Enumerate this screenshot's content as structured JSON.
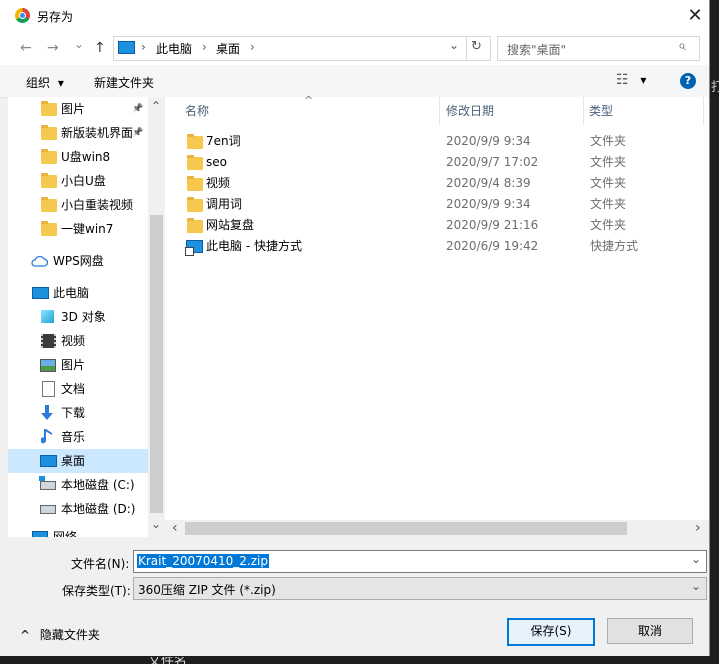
{
  "window": {
    "title": "另存为",
    "close_glyph": "✕"
  },
  "nav": {
    "back_glyph": "←",
    "forward_glyph": "→",
    "history_glyph": "⌄",
    "up_glyph": "↑",
    "breadcrumbs": [
      "此电脑",
      "桌面"
    ],
    "sep": "›",
    "addr_dropdown_glyph": "⌄",
    "refresh_glyph": "↻",
    "search_placeholder": "搜索\"桌面\"",
    "search_glyph": "⌕"
  },
  "toolbar": {
    "organize_label": "组织",
    "organize_arrow": "▾",
    "new_folder_label": "新建文件夹",
    "view_glyph": "☷",
    "view_arrow": "▾",
    "help_glyph": "?"
  },
  "tree": {
    "quick": [
      {
        "label": "图片",
        "pinned": true
      },
      {
        "label": "新版装机界面",
        "pinned": true
      },
      {
        "label": "U盘win8",
        "pinned": false
      },
      {
        "label": "小白U盘",
        "pinned": false
      },
      {
        "label": "小白重装视频",
        "pinned": false
      },
      {
        "label": "一键win7",
        "pinned": false
      }
    ],
    "pin_glyph": "📌",
    "cloud": "WPS网盘",
    "pc": "此电脑",
    "pc_children": [
      "3D 对象",
      "视频",
      "图片",
      "文档",
      "下载",
      "音乐",
      "桌面",
      "本地磁盘 (C:)",
      "本地磁盘 (D:)"
    ],
    "selected": "桌面",
    "partial_label": "网络",
    "scroll_up": "⌃",
    "scroll_down": "⌄"
  },
  "columns": {
    "name": "名称",
    "date": "修改日期",
    "type": "类型",
    "sort_glyph": "^"
  },
  "files": [
    {
      "name": "7en词",
      "date": "2020/9/9 9:34",
      "type": "文件夹",
      "icon": "folder-icon"
    },
    {
      "name": "seo",
      "date": "2020/9/7 17:02",
      "type": "文件夹",
      "icon": "folder-icon"
    },
    {
      "name": "视频",
      "date": "2020/9/4 8:39",
      "type": "文件夹",
      "icon": "folder-icon"
    },
    {
      "name": "调用词",
      "date": "2020/9/9 9:34",
      "type": "文件夹",
      "icon": "folder-icon"
    },
    {
      "name": "网站复盘",
      "date": "2020/9/9 21:16",
      "type": "文件夹",
      "icon": "folder-icon"
    },
    {
      "name": "此电脑 - 快捷方式",
      "date": "2020/6/9 19:42",
      "type": "快捷方式",
      "icon": "computer-shortcut-icon"
    }
  ],
  "hscroll": {
    "left": "‹",
    "right": "›"
  },
  "form": {
    "filename_label": "文件名(N):",
    "filename_value": "Krait_20070410_2.zip",
    "filetype_label": "保存类型(T):",
    "filetype_value": "360压缩 ZIP 文件 (*.zip)",
    "dropdown_glyph": "⌄"
  },
  "footer": {
    "hide_folders_label": "隐藏文件夹",
    "hide_folders_glyph": "^",
    "save_label": "保存(S)",
    "cancel_label": "取消"
  },
  "background": {
    "bottom_text": "文件名",
    "right_text": "打"
  },
  "colors": {
    "selection": "#cce8ff",
    "highlight": "#0078d7",
    "folder": "#f6c94e",
    "link": "#0063b1"
  }
}
